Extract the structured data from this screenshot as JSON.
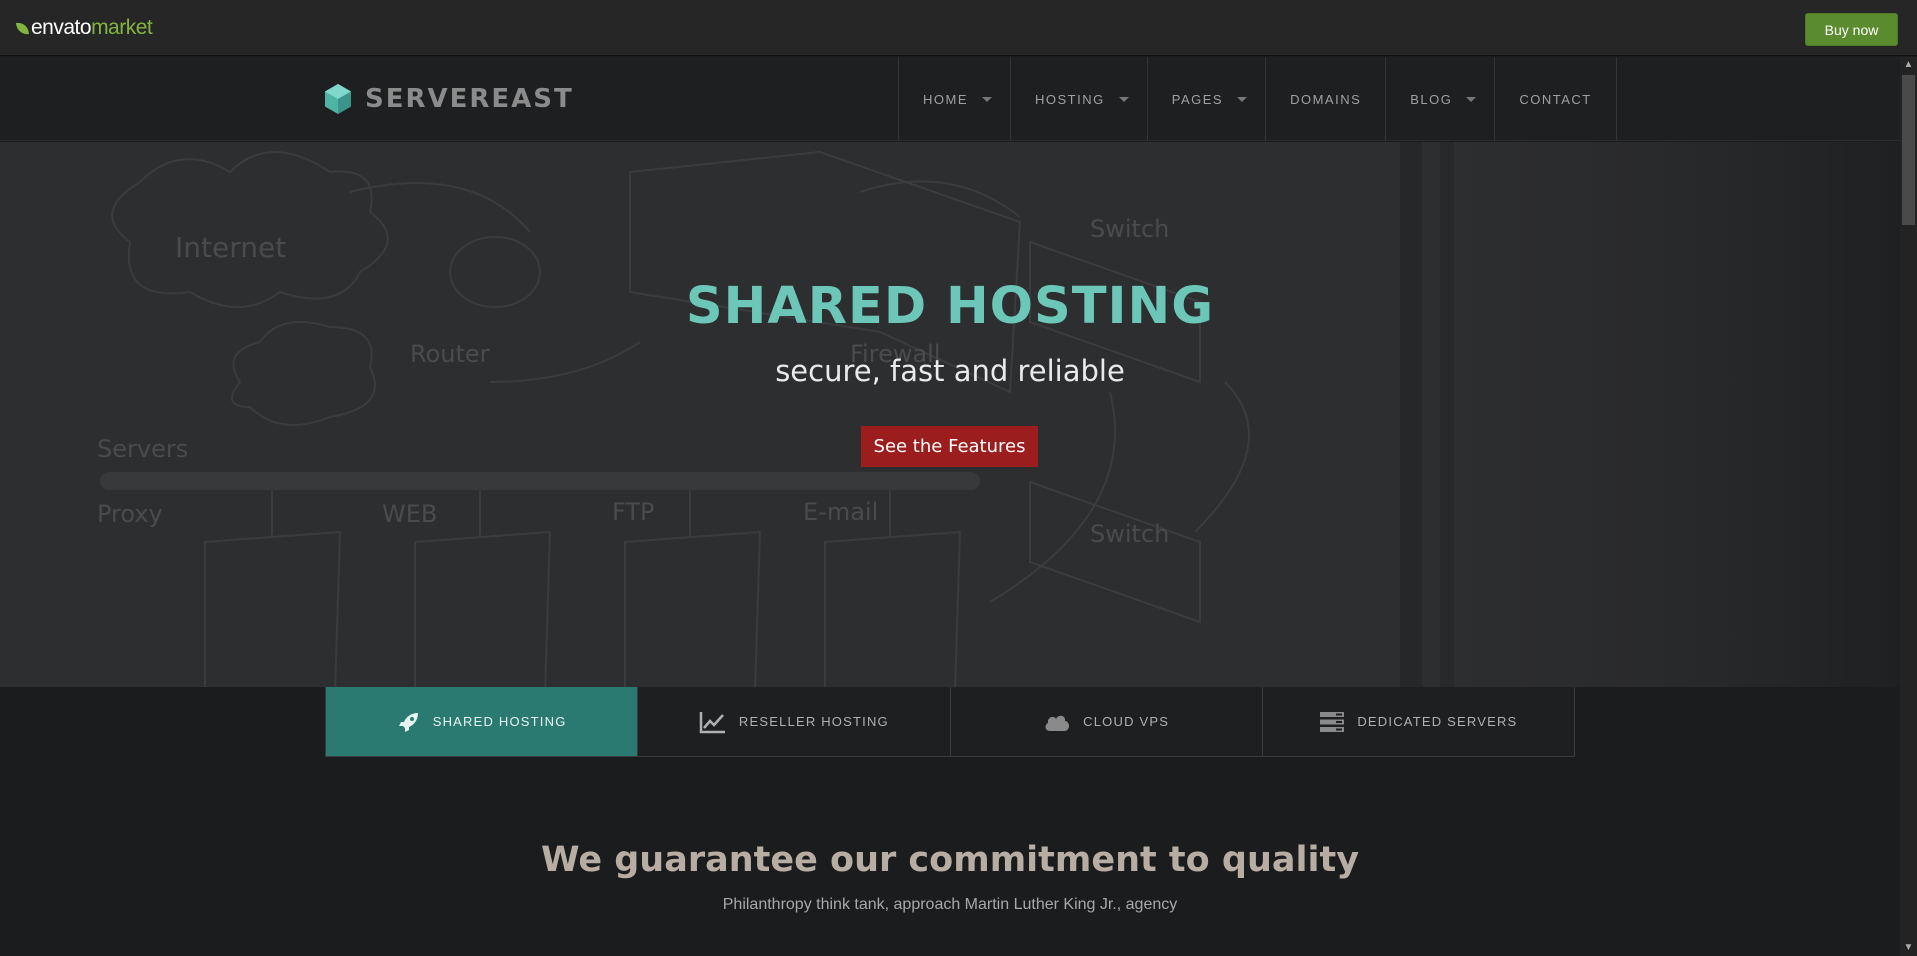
{
  "envato": {
    "logo_word": "envato",
    "logo_accent": "market",
    "buy_label": "Buy now"
  },
  "header": {
    "brand": "SERVEREAST",
    "nav": [
      {
        "label": "HOME",
        "dropdown": true
      },
      {
        "label": "HOSTING",
        "dropdown": true
      },
      {
        "label": "PAGES",
        "dropdown": true
      },
      {
        "label": "DOMAINS",
        "dropdown": false
      },
      {
        "label": "BLOG",
        "dropdown": true
      },
      {
        "label": "CONTACT",
        "dropdown": false
      }
    ]
  },
  "hero": {
    "title": "SHARED HOSTING",
    "subtitle": "secure, fast and reliable",
    "cta": "See the Features",
    "sketch_labels": [
      "Internet",
      "Router",
      "Firewall",
      "Switch",
      "Switch",
      "Servers",
      "Proxy",
      "WEB",
      "FTP",
      "E-mail"
    ]
  },
  "tabs": [
    {
      "label": "SHARED HOSTING",
      "icon": "rocket-icon",
      "active": true
    },
    {
      "label": "RESELLER HOSTING",
      "icon": "chart-icon",
      "active": false
    },
    {
      "label": "CLOUD VPS",
      "icon": "cloud-icon",
      "active": false
    },
    {
      "label": "DEDICATED SERVERS",
      "icon": "server-icon",
      "active": false
    }
  ],
  "quality": {
    "title": "We guarantee our commitment to quality",
    "subtitle": "Philanthropy think tank, approach Martin Luther King Jr., agency"
  },
  "colors": {
    "accent": "#6cc7b8",
    "tab_active": "#2b7a71",
    "cta": "#9b1d1d",
    "envato_green": "#82b440"
  }
}
